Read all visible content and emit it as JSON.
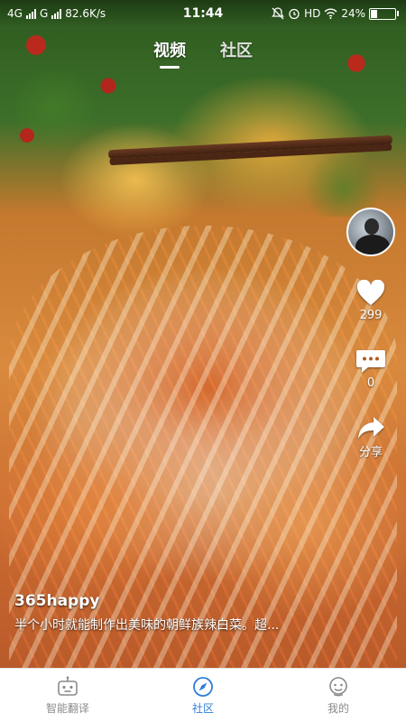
{
  "status_bar": {
    "network": "4G",
    "network2": "G",
    "speed": "82.6K/s",
    "time": "11:44",
    "hd": "HD",
    "battery": "24%",
    "battery_level": 0.24
  },
  "top_tabs": [
    {
      "label": "视频",
      "active": true
    },
    {
      "label": "社区",
      "active": false
    }
  ],
  "actions": {
    "like_count": "299",
    "comment_count": "0",
    "share_label": "分享"
  },
  "caption": {
    "username": "365happy",
    "description": "半个小时就能制作出美味的朝鲜族辣白菜。超..."
  },
  "bottom_nav": [
    {
      "label": "智能翻译",
      "icon": "robot-icon",
      "active": false
    },
    {
      "label": "社区",
      "icon": "compass-icon",
      "active": true
    },
    {
      "label": "我的",
      "icon": "user-face-icon",
      "active": false
    }
  ],
  "colors": {
    "accent": "#2f7ed8",
    "inactive": "#8a8a8a"
  }
}
